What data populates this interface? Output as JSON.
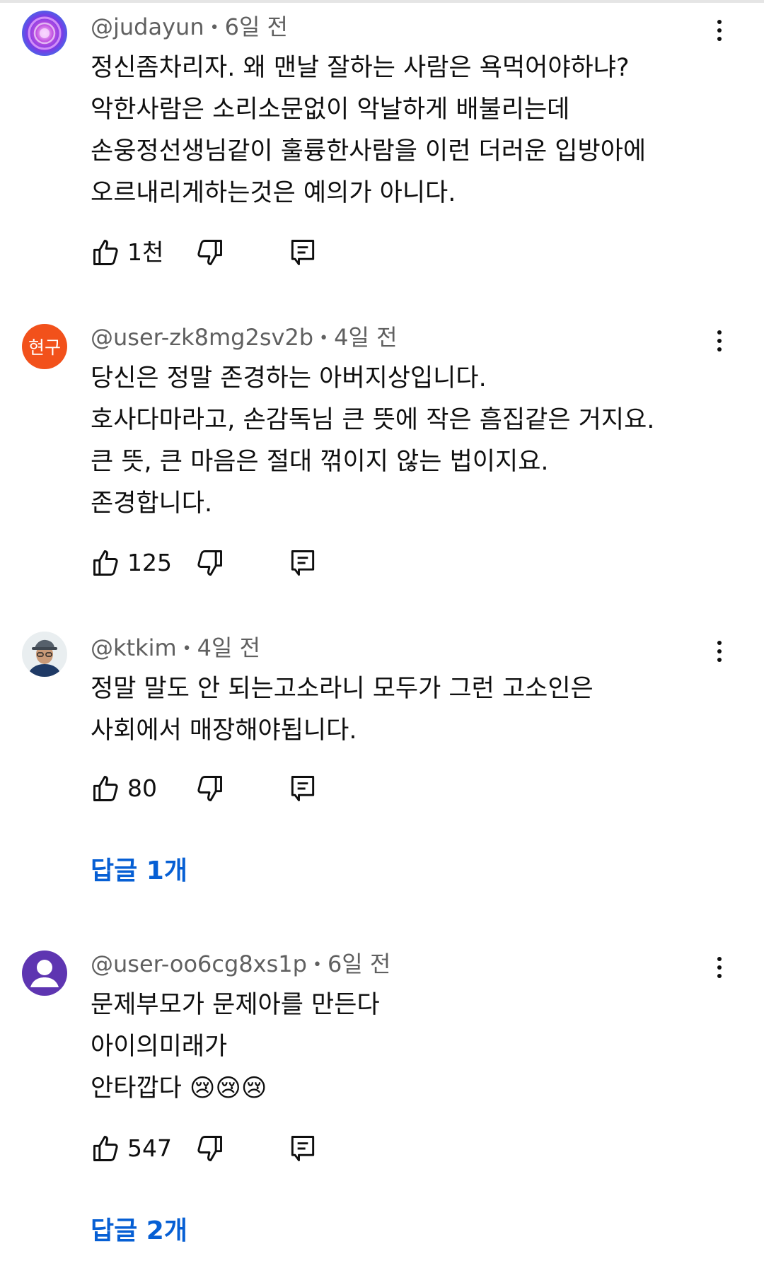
{
  "comments": [
    {
      "handle": "@judayun",
      "separator": "•",
      "time": "6일 전",
      "avatar": {
        "type": "image",
        "icon": "purple-rose-avatar"
      },
      "lines": [
        "정신좀차리자. 왜 맨날 잘하는 사람은 욕먹어야하냐?",
        "악한사람은 소리소문없이 악날하게 배불리는데",
        "손웅정선생님같이 훌륭한사람을 이런 더러운  입방아에",
        "오르내리게하는것은 예의가 아니다."
      ],
      "likes": "1천"
    },
    {
      "handle": "@user-zk8mg2sv2b",
      "separator": "•",
      "time": "4일 전",
      "avatar": {
        "type": "initials",
        "initials": "현구",
        "color": "#f2511b"
      },
      "lines": [
        "당신은 정말 존경하는 아버지상입니다.",
        "호사다마라고, 손감독님 큰 뜻에 작은 흠집같은 거지요.",
        "큰 뜻, 큰 마음은 절대 꺾이지 않는 법이지요.",
        "존경합니다."
      ],
      "likes": "125"
    },
    {
      "handle": "@ktkim",
      "separator": "•",
      "time": "4일 전",
      "avatar": {
        "type": "image",
        "icon": "man-with-cap-avatar"
      },
      "lines": [
        "정말 말도 안 되는고소라니 모두가 그런 고소인은",
        "사회에서 매장해야됩니다."
      ],
      "likes": "80",
      "replies": "답글 1개"
    },
    {
      "handle": "@user-oo6cg8xs1p",
      "separator": "•",
      "time": "6일 전",
      "avatar": {
        "type": "default",
        "icon": "default-person-avatar",
        "color": "#5e35b1"
      },
      "lines": [
        "문제부모가 문제아를 만든다",
        "아이의미래가",
        "안타깝다 😢😢😢"
      ],
      "likes": "547",
      "replies": "답글 2개"
    }
  ],
  "icons": {
    "like": "thumbs-up-icon",
    "dislike": "thumbs-down-icon",
    "reply": "reply-comment-icon",
    "more": "more-vert-icon"
  },
  "colors": {
    "text": "#0f0f0f",
    "meta": "#606060",
    "link": "#065fd4"
  }
}
